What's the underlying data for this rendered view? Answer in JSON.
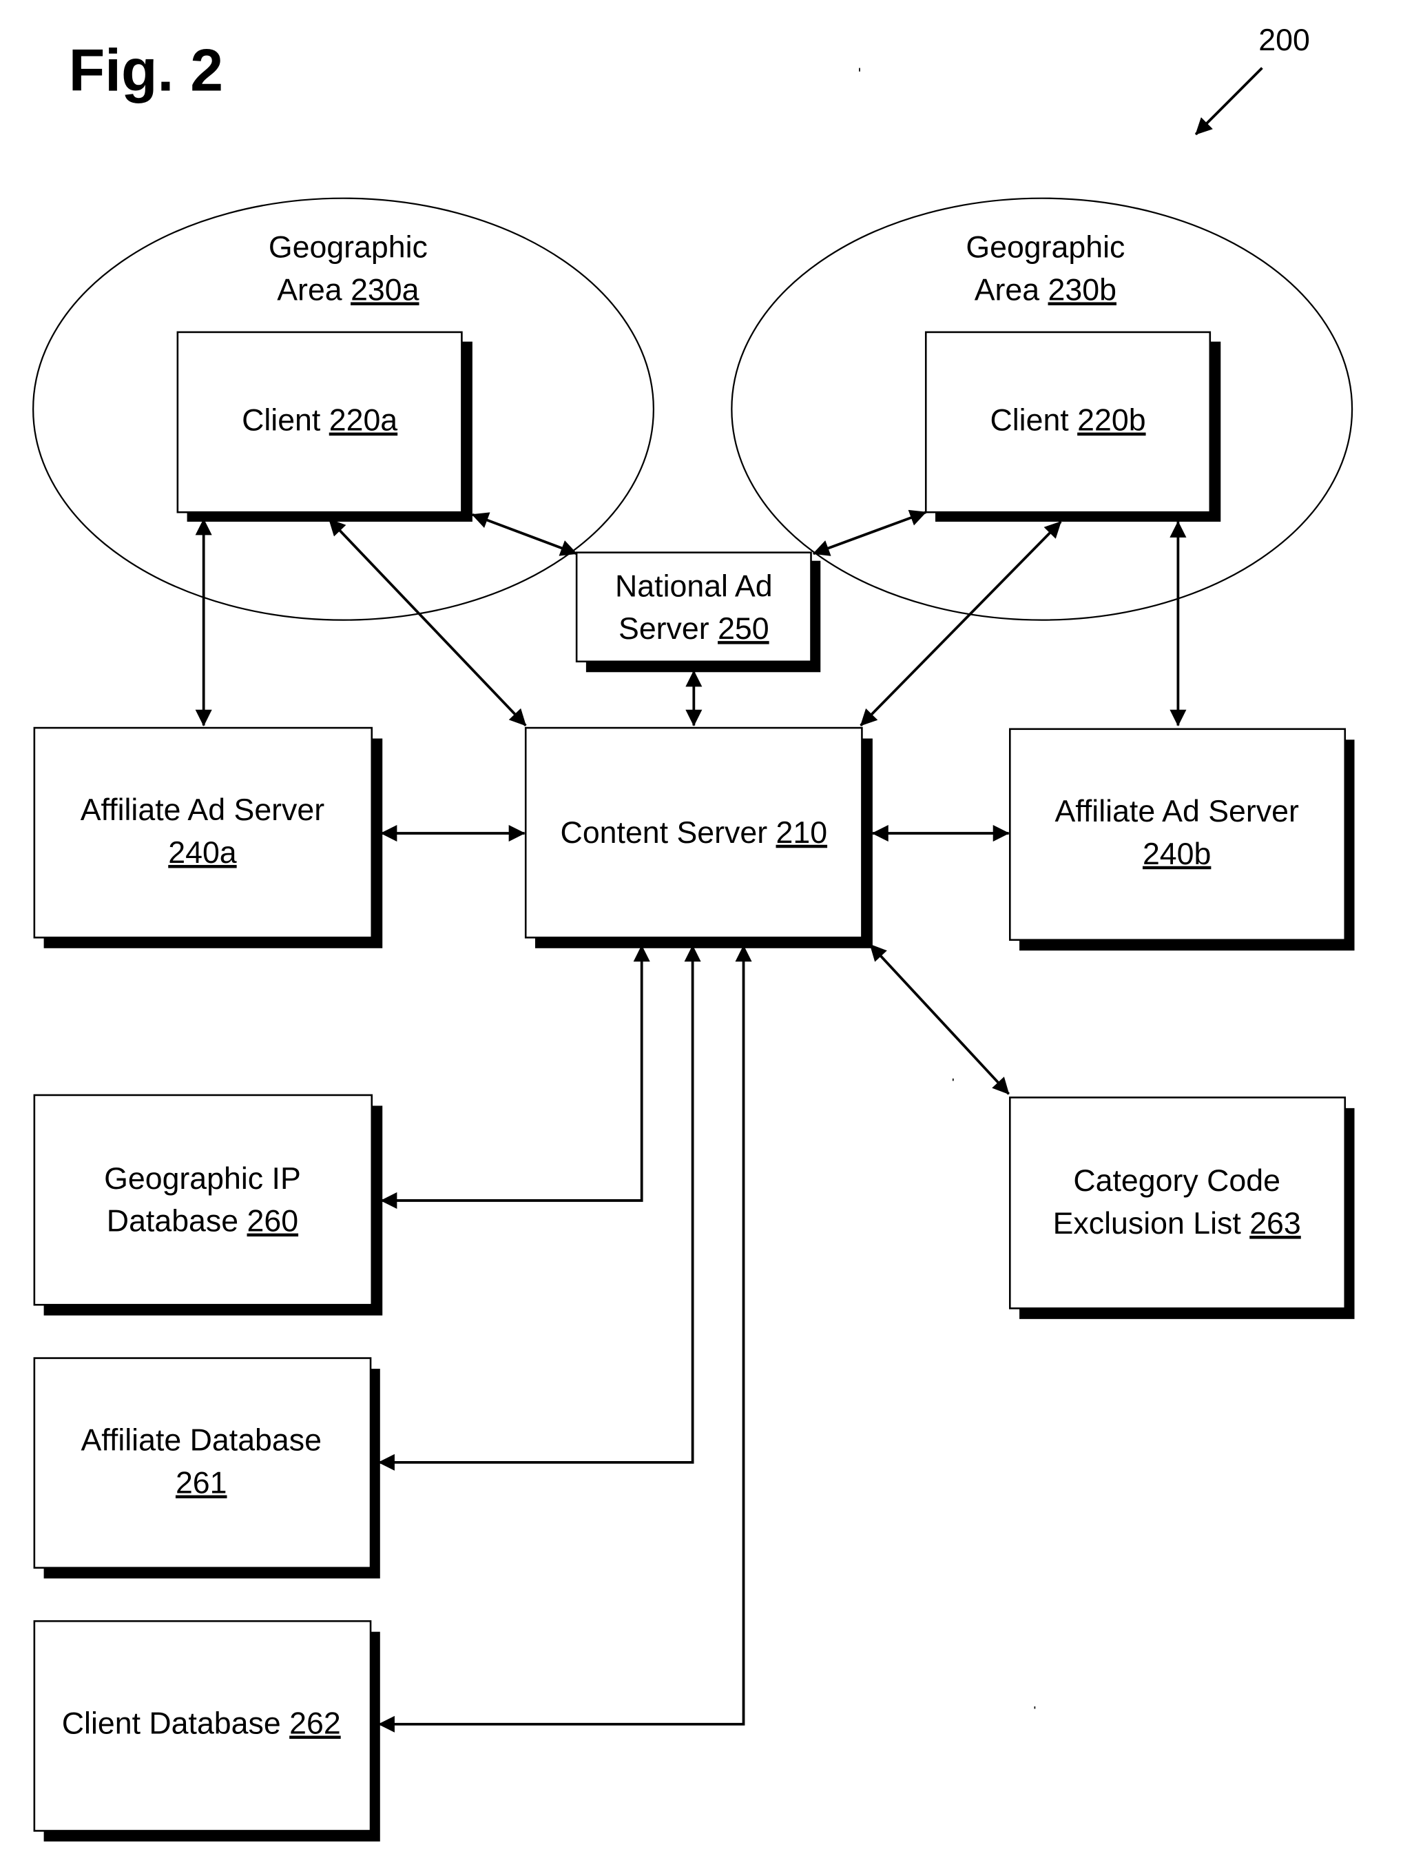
{
  "figure": {
    "title": "Fig. 2",
    "reference": "200"
  },
  "areas": [
    {
      "id": "230a",
      "line1": "Geographic",
      "line2_prefix": "Area ",
      "ref": "230a"
    },
    {
      "id": "230b",
      "line1": "Geographic",
      "line2_prefix": "Area ",
      "ref": "230b"
    }
  ],
  "nodes": {
    "client_a": {
      "lines": [
        {
          "text": "Client ",
          "ref": "220a"
        }
      ]
    },
    "client_b": {
      "lines": [
        {
          "text": "Client ",
          "ref": "220b"
        }
      ]
    },
    "national_ad_server": {
      "lines": [
        {
          "text": "National Ad",
          "ref": ""
        },
        {
          "text": "Server ",
          "ref": "250"
        }
      ]
    },
    "affiliate_ad_server_a": {
      "lines": [
        {
          "text": "Affiliate Ad Server",
          "ref": ""
        },
        {
          "text": "",
          "ref": "240a"
        }
      ]
    },
    "content_server": {
      "lines": [
        {
          "text": "Content Server ",
          "ref": "210"
        }
      ]
    },
    "affiliate_ad_server_b": {
      "lines": [
        {
          "text": "Affiliate Ad Server",
          "ref": ""
        },
        {
          "text": "",
          "ref": "240b"
        }
      ]
    },
    "geographic_ip_database": {
      "lines": [
        {
          "text": "Geographic IP",
          "ref": ""
        },
        {
          "text": "Database ",
          "ref": "260"
        }
      ]
    },
    "category_code_exclusion_list": {
      "lines": [
        {
          "text": "Category Code",
          "ref": ""
        },
        {
          "text": "Exclusion List ",
          "ref": "263"
        }
      ]
    },
    "affiliate_database": {
      "lines": [
        {
          "text": "Affiliate Database",
          "ref": ""
        },
        {
          "text": "",
          "ref": "261"
        }
      ]
    },
    "client_database": {
      "lines": [
        {
          "text": "Client Database ",
          "ref": "262"
        }
      ]
    }
  },
  "connections": [
    {
      "from": "client_a",
      "to": "affiliate_ad_server_a",
      "direction": "bidirectional"
    },
    {
      "from": "client_a",
      "to": "content_server",
      "direction": "bidirectional"
    },
    {
      "from": "client_a",
      "to": "national_ad_server",
      "direction": "bidirectional"
    },
    {
      "from": "client_b",
      "to": "national_ad_server",
      "direction": "bidirectional"
    },
    {
      "from": "client_b",
      "to": "content_server",
      "direction": "bidirectional"
    },
    {
      "from": "client_b",
      "to": "affiliate_ad_server_b",
      "direction": "bidirectional"
    },
    {
      "from": "national_ad_server",
      "to": "content_server",
      "direction": "bidirectional"
    },
    {
      "from": "affiliate_ad_server_a",
      "to": "content_server",
      "direction": "bidirectional"
    },
    {
      "from": "content_server",
      "to": "affiliate_ad_server_b",
      "direction": "bidirectional"
    },
    {
      "from": "content_server",
      "to": "category_code_exclusion_list",
      "direction": "bidirectional"
    },
    {
      "from": "content_server",
      "to": "geographic_ip_database",
      "direction": "bidirectional"
    },
    {
      "from": "content_server",
      "to": "affiliate_database",
      "direction": "bidirectional"
    },
    {
      "from": "content_server",
      "to": "client_database",
      "direction": "bidirectional"
    }
  ]
}
